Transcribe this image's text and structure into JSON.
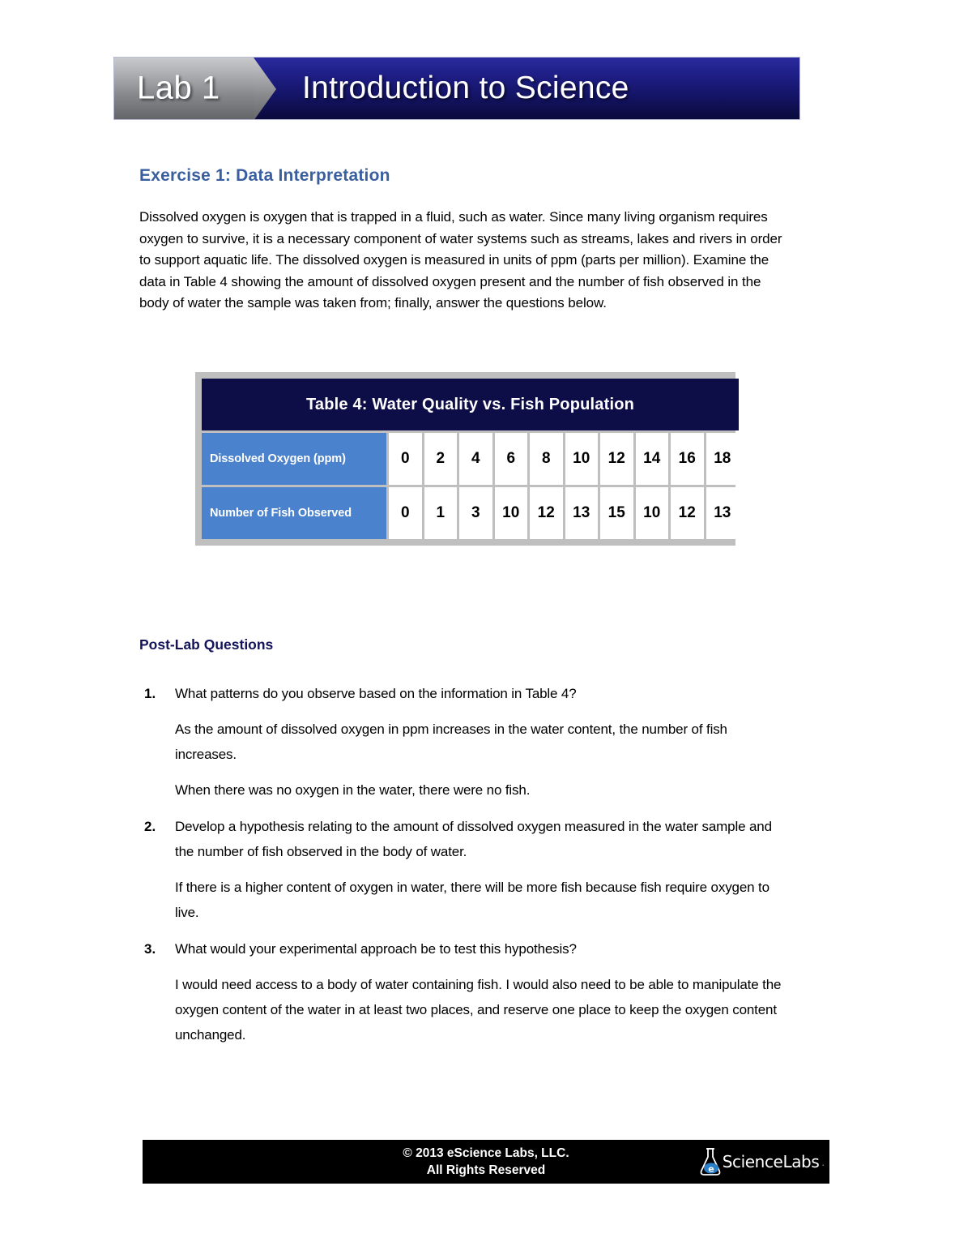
{
  "banner": {
    "lab_label": "Lab 1",
    "title": "Introduction to Science"
  },
  "exercise": {
    "heading": "Exercise 1: Data Interpretation",
    "intro": "Dissolved oxygen is oxygen that is trapped in a fluid, such as water. Since many living organism requires oxygen to survive, it is a necessary component of water systems such as streams, lakes and rivers in order to support aquatic life. The dissolved oxygen is measured in units of ppm (parts per million). Examine the data in Table 4 showing the amount of dissolved oxygen present and the number of fish observed in the body of water the sample was taken from; finally, answer the questions below."
  },
  "table": {
    "title": "Table 4: Water Quality vs. Fish Population",
    "row1_label": "Dissolved Oxygen (ppm)",
    "row1_values": [
      "0",
      "2",
      "4",
      "6",
      "8",
      "10",
      "12",
      "14",
      "16",
      "18"
    ],
    "row2_label": "Number of Fish Observed",
    "row2_values": [
      "0",
      "1",
      "3",
      "10",
      "12",
      "13",
      "15",
      "10",
      "12",
      "13"
    ]
  },
  "postlab": {
    "heading": "Post-Lab Questions",
    "questions": [
      {
        "number": "1.",
        "text": "What patterns do you observe based on the information in Table 4?",
        "answers": [
          "As the amount of dissolved oxygen in ppm increases in the water content, the number of fish increases.",
          "When there was no oxygen in the water, there were no fish."
        ]
      },
      {
        "number": "2.",
        "text": "Develop a hypothesis relating to the amount of dissolved oxygen measured in the water sample and the number of fish observed in the body of water.",
        "answers": [
          "If there is a higher content of oxygen in water, there will be more fish because fish require oxygen to live."
        ]
      },
      {
        "number": "3.",
        "text": "What would your experimental approach be to test this hypothesis?",
        "answers": [
          "I would need access to a body of water containing fish. I would also need to be able to manipulate the oxygen content of the water in at least two places, and reserve one place to keep the oxygen content unchanged."
        ]
      }
    ]
  },
  "footer": {
    "copyright": "© 2013 eScience Labs, LLC.",
    "rights": "All Rights Reserved",
    "logo_text": "ScienceLabs",
    "logo_suffix": "."
  },
  "colors": {
    "heading_blue": "#3a5f9e",
    "postlab_navy": "#14145a",
    "table_header_navy": "#0d0d47",
    "table_label_blue": "#4a82ce",
    "table_frame_gray": "#bfbfbf",
    "banner_blue": "#1e1e86",
    "footer_black": "#000000",
    "logo_accent_blue": "#2a7fc9"
  },
  "chart_data": {
    "type": "table",
    "title": "Table 4: Water Quality vs. Fish Population",
    "categories": [
      0,
      2,
      4,
      6,
      8,
      10,
      12,
      14,
      16,
      18
    ],
    "series": [
      {
        "name": "Number of Fish Observed",
        "values": [
          0,
          1,
          3,
          10,
          12,
          13,
          15,
          10,
          12,
          13
        ]
      }
    ],
    "xlabel": "Dissolved Oxygen (ppm)",
    "ylabel": "Number of Fish Observed"
  }
}
